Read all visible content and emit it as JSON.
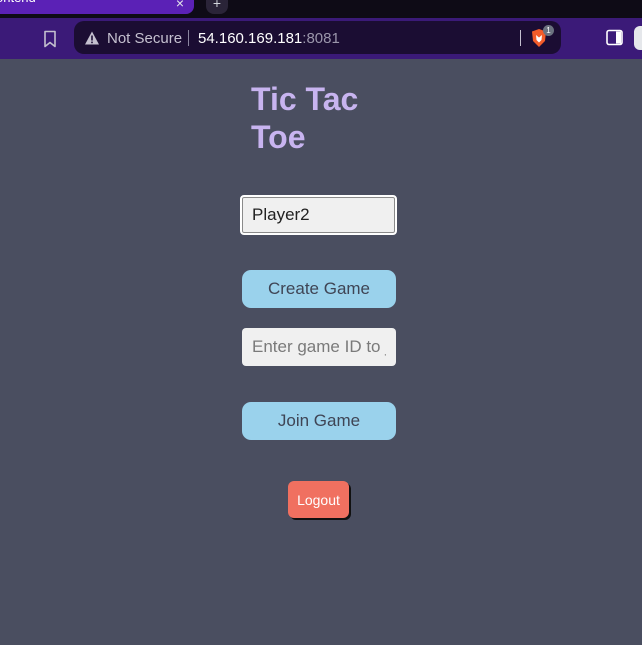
{
  "browser": {
    "tab_title": "ontend",
    "tab_close": "×",
    "new_tab": "+",
    "security_label": "Not Secure",
    "url_host": "54.160.169.181",
    "url_port": ":8081",
    "shield_badge_count": "1",
    "colors": {
      "tab": "#5b21b6",
      "toolbar": "#3b1a78",
      "addressbar": "#1b0d33"
    }
  },
  "page": {
    "title": "Tic Tac Toe",
    "username_value": "Player2",
    "create_label": "Create Game",
    "gameid_placeholder": "Enter game ID to join",
    "join_label": "Join Game",
    "logout_label": "Logout",
    "colors": {
      "background": "#4a4e60",
      "title": "#c8b4f0",
      "primary_button": "#9ad2ec",
      "logout_button": "#f07060"
    }
  }
}
